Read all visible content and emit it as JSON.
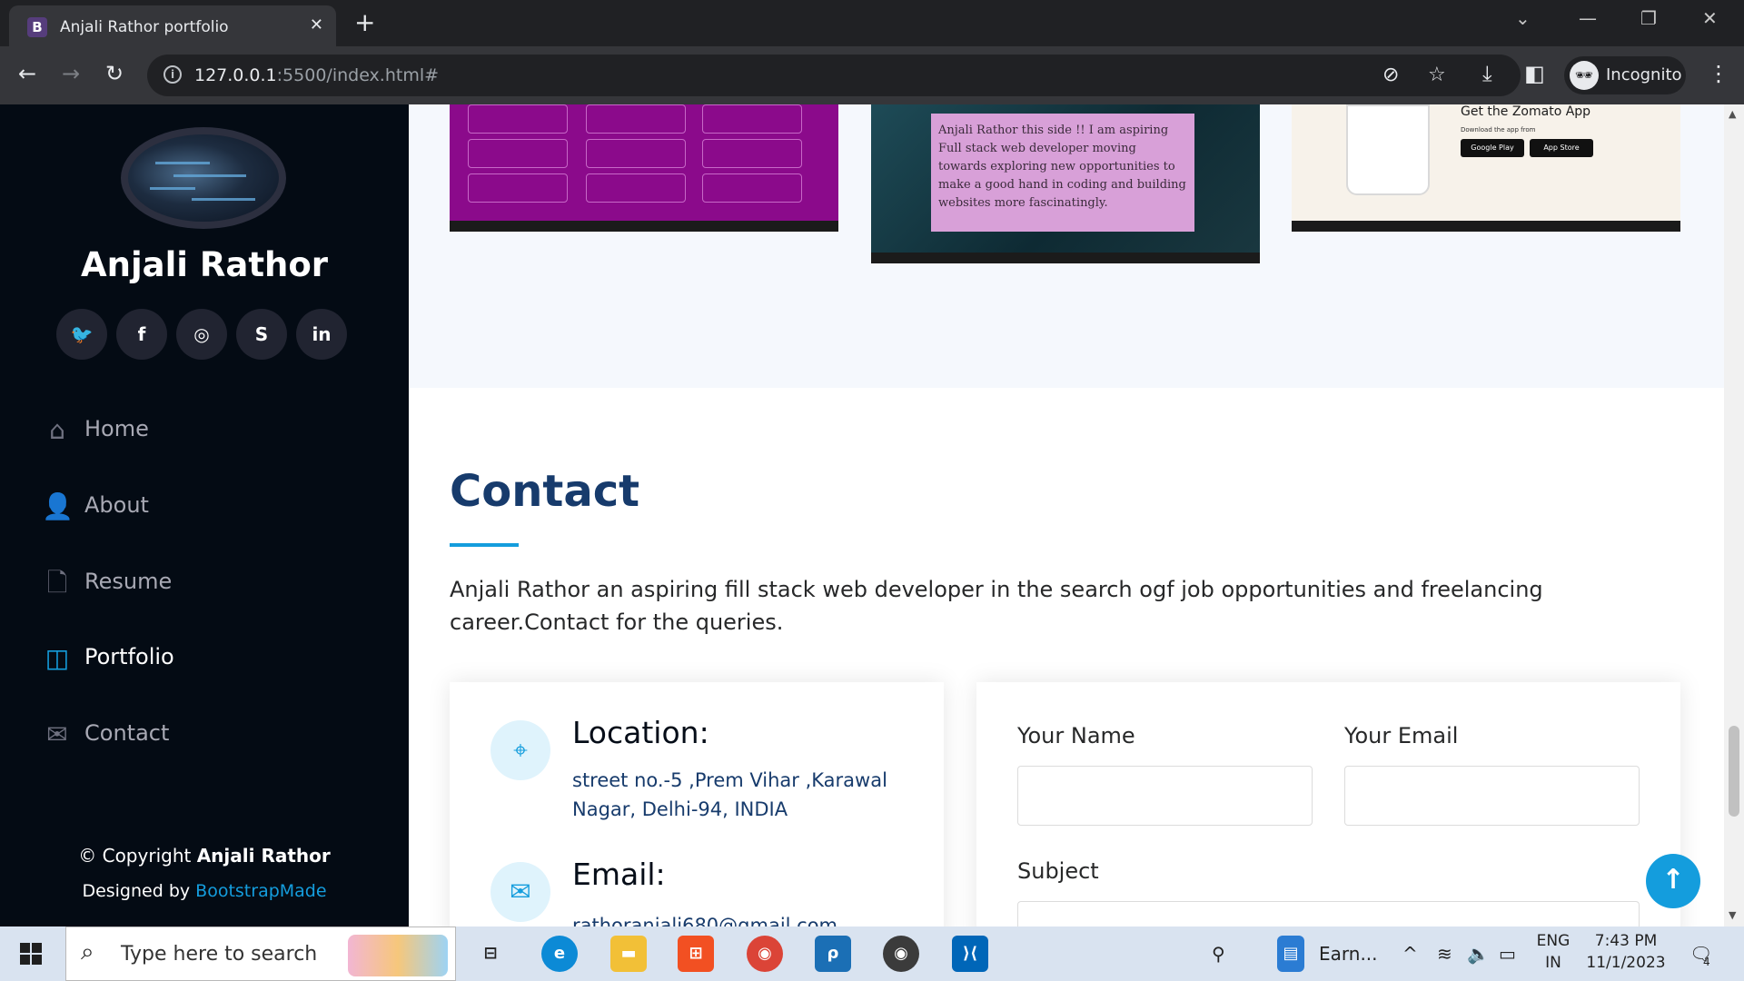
{
  "browser": {
    "tab_title": "Anjali Rathor portfolio",
    "favicon": "B",
    "url_host": "127.0.0.1",
    "url_path": ":5500/index.html#",
    "profile_label": "Incognito"
  },
  "sidebar": {
    "name": "Anjali Rathor",
    "social": [
      {
        "icon": "twitter-icon",
        "glyph": "🐦"
      },
      {
        "icon": "facebook-icon",
        "glyph": "f"
      },
      {
        "icon": "instagram-icon",
        "glyph": "◎"
      },
      {
        "icon": "skype-icon",
        "glyph": "S"
      },
      {
        "icon": "linkedin-icon",
        "glyph": "in"
      }
    ],
    "nav": [
      {
        "label": "Home",
        "icon": "home-icon",
        "glyph": "⌂"
      },
      {
        "label": "About",
        "icon": "person-icon",
        "glyph": "👤"
      },
      {
        "label": "Resume",
        "icon": "file-icon",
        "glyph": "🗋"
      },
      {
        "label": "Portfolio",
        "icon": "portfolio-icon",
        "glyph": "◫"
      },
      {
        "label": "Contact",
        "icon": "envelope-icon",
        "glyph": "✉"
      }
    ],
    "active_nav": "Portfolio",
    "copyright_prefix": "© Copyright ",
    "copyright_name": "Anjali Rathor",
    "designed_by": "Designed by ",
    "designer_link": "BootstrapMade"
  },
  "portfolio": {
    "card_text": "Anjali Rathor this side !!  I am aspiring Full stack web developer moving towards exploring new opportunities to make a good hand in coding and building websites more fascinatingly.",
    "zomato_title": "Get the Zomato App",
    "zomato_sub": "Download the app from",
    "google_play": "Google Play",
    "app_store": "App Store"
  },
  "contact": {
    "title": "Contact",
    "description": "Anjali Rathor an aspiring fill stack web developer in the search ogf job opportunities and freelancing career.Contact for the queries.",
    "location_heading": "Location:",
    "location_text": "street no.-5 ,Prem Vihar ,Karawal Nagar, Delhi-94, INDIA",
    "email_heading": "Email:",
    "email_text": "rathoranjali680@gmail.com",
    "form": {
      "name_label": "Your Name",
      "email_label": "Your Email",
      "subject_label": "Subject"
    }
  },
  "taskbar": {
    "search_placeholder": "Type here to search",
    "running_app": "Earn...",
    "lang_line1": "ENG",
    "lang_line2": "IN",
    "time": "7:43 PM",
    "date": "11/1/2023",
    "notifications": "4"
  },
  "colors": {
    "accent": "#149ddd",
    "sidebar_bg": "#040b14",
    "heading": "#173b6c"
  }
}
